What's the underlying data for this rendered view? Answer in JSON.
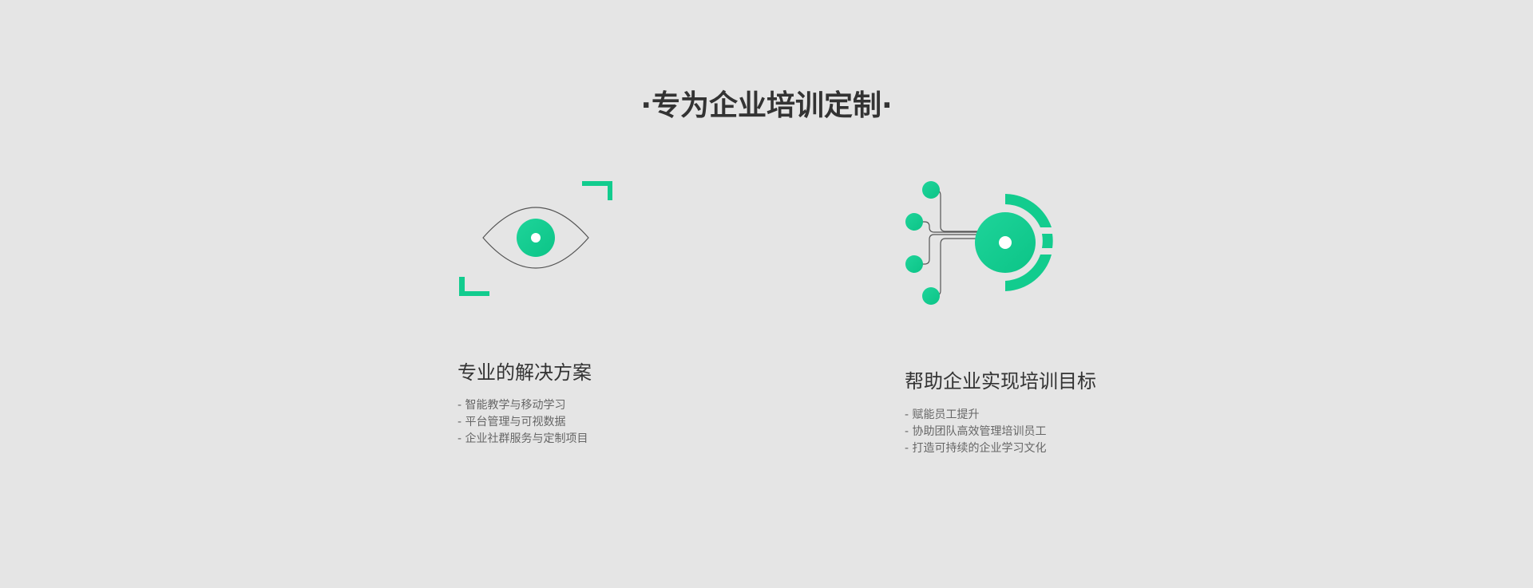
{
  "section": {
    "title": "·专为企业培训定制·"
  },
  "colors": {
    "accent": "#12cc8e",
    "background": "#e5e5e5",
    "heading": "#333333",
    "body_text": "#666666"
  },
  "features": [
    {
      "icon": "eye-icon",
      "heading": "专业的解决方案",
      "items": [
        "- 智能教学与移动学习",
        "- 平台管理与可视数据",
        "- 企业社群服务与定制项目"
      ]
    },
    {
      "icon": "network-target-icon",
      "heading": "帮助企业实现培训目标",
      "items": [
        "- 赋能员工提升",
        "- 协助团队高效管理培训员工",
        "- 打造可持续的企业学习文化"
      ]
    }
  ]
}
